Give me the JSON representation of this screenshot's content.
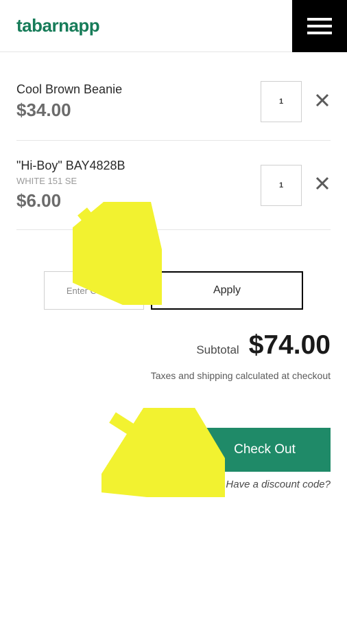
{
  "header": {
    "logo": "tabarnapp"
  },
  "cart_items": [
    {
      "name": "Cool Brown Beanie",
      "variant": "",
      "price": "$34.00",
      "qty": "1"
    },
    {
      "name": "\"Hi-Boy\" BAY4828B",
      "variant": "WHITE 151 SE",
      "price": "$6.00",
      "qty": "1"
    }
  ],
  "coupon": {
    "placeholder": "Enter Coupon",
    "apply_label": "Apply"
  },
  "subtotal": {
    "label": "Subtotal",
    "amount": "$74.00"
  },
  "tax_note": "Taxes and shipping calculated at checkout",
  "checkout_label": "Check Out",
  "discount_link": "Have a discount code?"
}
